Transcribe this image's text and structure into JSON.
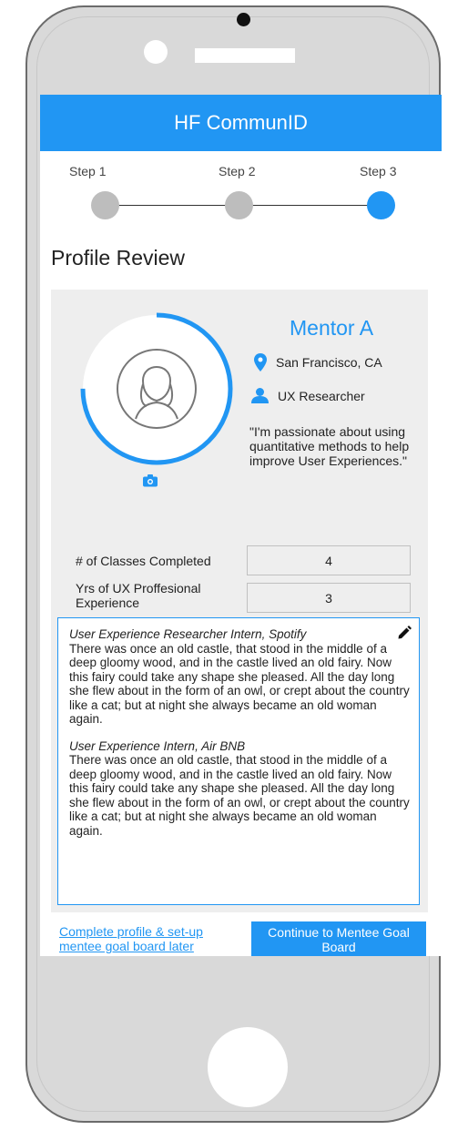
{
  "app": {
    "title": "HF CommunID"
  },
  "steps": [
    {
      "label": "Step 1",
      "state": "complete"
    },
    {
      "label": "Step 2",
      "state": "complete"
    },
    {
      "label": "Step 3",
      "state": "current"
    }
  ],
  "page": {
    "title": "Profile Review"
  },
  "profile": {
    "name": "Mentor A",
    "location": "San Francisco, CA",
    "role": "UX Researcher",
    "bio": "\"I'm passionate about using quantitative methods to help improve User Experiences.\"",
    "completion_fraction": 0.75,
    "avatar_icon": "user-silhouette-icon",
    "photo_icon": "camera-icon"
  },
  "stats": [
    {
      "label": "# of Classes Completed",
      "value": "4"
    },
    {
      "label": "Yrs of UX Proffesional Experience",
      "value": "3"
    }
  ],
  "experience": [
    {
      "title": "User Experience Researcher Intern, Spotify",
      "description": "There was once an old castle, that stood in the middle of a deep gloomy wood, and in the castle lived an old fairy. Now this fairy could take any shape she pleased. All the day long she flew about in the form of an owl, or crept about the country like a cat; but at night she always became an old woman again."
    },
    {
      "title": "User Experience Intern, Air BNB",
      "description": "There was once an old castle, that stood in the middle of a deep gloomy wood, and in the castle lived an old fairy. Now this fairy could take any shape she pleased. All the day long she flew about in the form of an owl, or crept about the country like a cat; but at night she always became an old woman again."
    }
  ],
  "actions": {
    "later_link": "Complete profile & set-up mentee goal board later",
    "continue_button": "Continue to Mentee Goal Board"
  },
  "colors": {
    "accent": "#2196f3",
    "inactive_step": "#bdbdbd",
    "card_bg": "#eeeeee"
  }
}
